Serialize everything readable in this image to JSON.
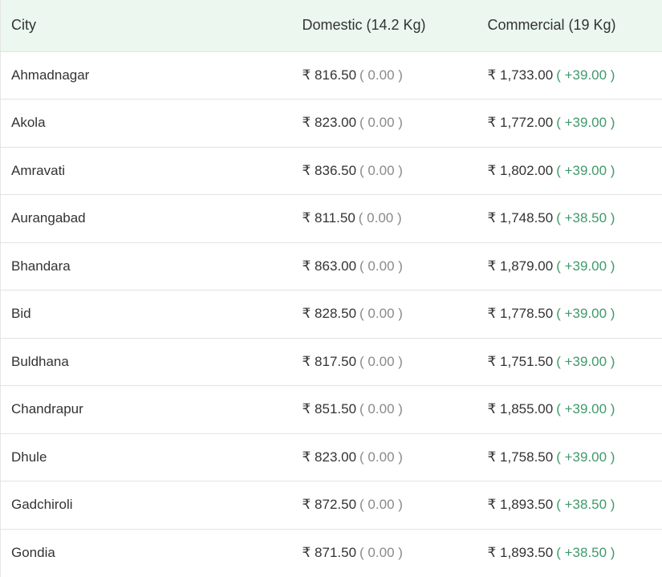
{
  "table": {
    "headers": {
      "city": "City",
      "domestic": "Domestic (14.2 Kg)",
      "commercial": "Commercial (19 Kg)"
    },
    "colors": {
      "header_bg": "#ebf7ef",
      "neutral_change": "#8a8a8a",
      "positive_change": "#3f9a6a"
    },
    "rows": [
      {
        "city": "Ahmadnagar",
        "domestic_price": "₹ 816.50",
        "domestic_change": "( 0.00 )",
        "commercial_price": "₹ 1,733.00",
        "commercial_change": "( +39.00 )"
      },
      {
        "city": "Akola",
        "domestic_price": "₹ 823.00",
        "domestic_change": "( 0.00 )",
        "commercial_price": "₹ 1,772.00",
        "commercial_change": "( +39.00 )"
      },
      {
        "city": "Amravati",
        "domestic_price": "₹ 836.50",
        "domestic_change": "( 0.00 )",
        "commercial_price": "₹ 1,802.00",
        "commercial_change": "( +39.00 )"
      },
      {
        "city": "Aurangabad",
        "domestic_price": "₹ 811.50",
        "domestic_change": "( 0.00 )",
        "commercial_price": "₹ 1,748.50",
        "commercial_change": "( +38.50 )"
      },
      {
        "city": "Bhandara",
        "domestic_price": "₹ 863.00",
        "domestic_change": "( 0.00 )",
        "commercial_price": "₹ 1,879.00",
        "commercial_change": "( +39.00 )"
      },
      {
        "city": "Bid",
        "domestic_price": "₹ 828.50",
        "domestic_change": "( 0.00 )",
        "commercial_price": "₹ 1,778.50",
        "commercial_change": "( +39.00 )"
      },
      {
        "city": "Buldhana",
        "domestic_price": "₹ 817.50",
        "domestic_change": "( 0.00 )",
        "commercial_price": "₹ 1,751.50",
        "commercial_change": "( +39.00 )"
      },
      {
        "city": "Chandrapur",
        "domestic_price": "₹ 851.50",
        "domestic_change": "( 0.00 )",
        "commercial_price": "₹ 1,855.00",
        "commercial_change": "( +39.00 )"
      },
      {
        "city": "Dhule",
        "domestic_price": "₹ 823.00",
        "domestic_change": "( 0.00 )",
        "commercial_price": "₹ 1,758.50",
        "commercial_change": "( +39.00 )"
      },
      {
        "city": "Gadchiroli",
        "domestic_price": "₹ 872.50",
        "domestic_change": "( 0.00 )",
        "commercial_price": "₹ 1,893.50",
        "commercial_change": "( +38.50 )"
      },
      {
        "city": "Gondia",
        "domestic_price": "₹ 871.50",
        "domestic_change": "( 0.00 )",
        "commercial_price": "₹ 1,893.50",
        "commercial_change": "( +38.50 )"
      }
    ]
  }
}
